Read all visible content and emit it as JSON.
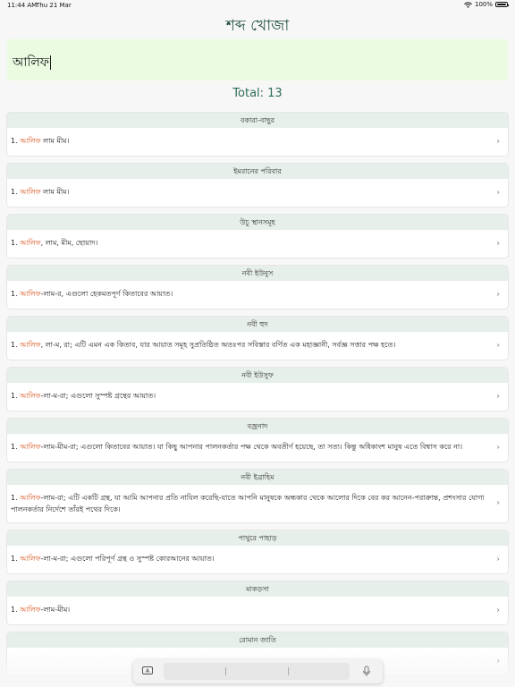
{
  "status": {
    "time": "11:44 AM",
    "date": "Thu 21 Mar",
    "battery": "100%"
  },
  "app": {
    "title": "শব্দ খোজা"
  },
  "search": {
    "value": "আলিফ"
  },
  "total": {
    "label": "Total: 13"
  },
  "results": [
    {
      "surah": "বকারা-বাছুর",
      "parts": [
        "1. ",
        "আলিফ",
        " লাম মীম।"
      ]
    },
    {
      "surah": "ইমরানের পরিবার",
      "parts": [
        "1. ",
        "আলিফ",
        " লাম মীম।"
      ]
    },
    {
      "surah": "উচু স্থানসমূহ",
      "parts": [
        "1. ",
        "আলিফ",
        ", লাম, মীম, ছোয়াদ।"
      ]
    },
    {
      "surah": "নবী ইউনুস",
      "parts": [
        "1. ",
        "আলিফ",
        "-লাম-র, এগুলো হেকমতপূর্ণ কিতাবের আয়াত।"
      ]
    },
    {
      "surah": "নবী হুদ",
      "parts": [
        "1. ",
        "আলিফ",
        ", লা-ম, রা; এটি এমন এক কিতাব, যার আয়াত সমূহ সুপ্রতিষ্ঠিত অতঃপর সবিস্তার বর্ণিত এক মহাজ্ঞানী, সর্বজ্ঞ সত্তার পক্ষ হতে।"
      ]
    },
    {
      "surah": "নবী ইউসুফ",
      "parts": [
        "1. ",
        "আলিফ",
        "-লা-ম-রা; এগুলো সুস্পষ্ট গ্রন্থের আয়াত।"
      ]
    },
    {
      "surah": "বজ্রনাদ",
      "parts": [
        "1. ",
        "আলিফ",
        "-লাম-মীম-রা; এগুলো কিতাবের আয়াত। যা কিছু আপনার পালনকর্তার পক্ষ থেকে অবতীর্ণ হয়েছে, তা সত্য। কিন্তু অধিকাংশ মানুষ এতে বিশ্বাস করে না।"
      ]
    },
    {
      "surah": "নবী ইব্রাহিম",
      "parts": [
        "1. ",
        "আলিফ",
        "-লাম-রা; এটি একটি গ্রন্থ, যা আমি আপনার প্রতি নাযিল করেছি-যাতে আপনি মানুষকে অন্ধকার থেকে আলোর দিকে বের কর আনেন-পরাক্রান্ত, প্রশংসার যোগ্য পালনকর্তার নির্দেশে তাঁরই পথের দিকে।"
      ]
    },
    {
      "surah": "পাথুরে পাহাড়",
      "parts": [
        "1. ",
        "আলিফ",
        "-লা-ম-রা; এগুলো পরিপূর্ণ গ্রন্থ ও সুস্পষ্ট কোরআনের আয়াত।"
      ]
    },
    {
      "surah": "মাকড়সা",
      "parts": [
        "1. ",
        "আলিফ",
        "-লাম-মীম।"
      ]
    },
    {
      "surah": "রোমান জাতি",
      "parts": [
        "",
        "",
        ""
      ]
    }
  ],
  "colors": {
    "keyword": "#d9531e",
    "header_bg": "#e7efea",
    "search_bg": "#eafbe2",
    "title": "#1f4e3d"
  },
  "icons": {
    "row_chevron": "chevron-right-icon",
    "keyboard": "keyboard-icon",
    "mic": "mic-icon",
    "wifi": "wifi-icon",
    "battery": "battery-icon"
  },
  "keyboard_bar": {
    "key_label": "A"
  }
}
